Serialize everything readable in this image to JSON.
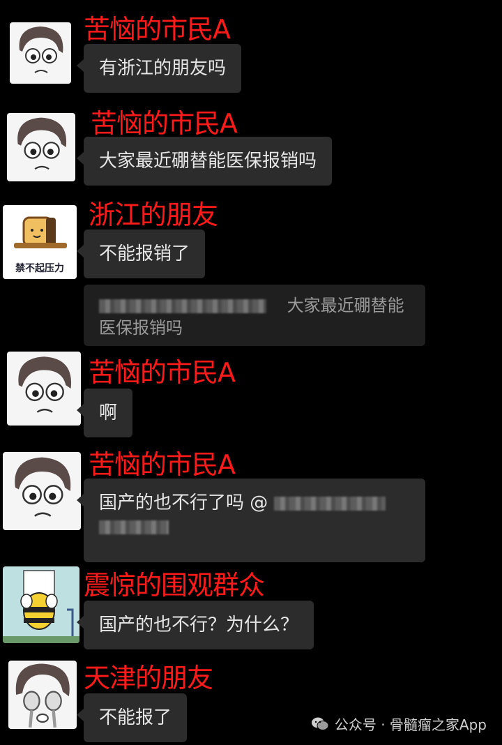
{
  "messages": [
    {
      "sender": "苦恼的市民A",
      "text": "有浙江的朋友吗",
      "avatar": "sad-girl-face-icon"
    },
    {
      "sender": "苦恼的市民A",
      "text": "大家最近硼替能医保报销吗",
      "avatar": "sad-girl-face-icon"
    },
    {
      "sender": "浙江的朋友",
      "text": "不能报销了",
      "avatar": "bread-sticker-icon",
      "avatar_caption": "禁不起压力",
      "quote_text_line1": "大家最近硼替能",
      "quote_text_line2": "医保报销吗"
    },
    {
      "sender": "苦恼的市民A",
      "text": "啊",
      "avatar": "sad-girl-face-icon"
    },
    {
      "sender": "苦恼的市民A",
      "text": "国产的也不行了吗 @",
      "avatar": "sad-girl-face-icon"
    },
    {
      "sender": "震惊的围观群众",
      "text": "国产的也不行？为什么？",
      "avatar": "bee-sticker-icon"
    },
    {
      "sender": "天津的朋友",
      "text": "不能报了",
      "avatar": "crying-face-icon"
    }
  ],
  "watermark": {
    "text": "公众号 · 骨髓瘤之家App",
    "icon": "wechat-icon"
  },
  "colors": {
    "background": "#000000",
    "bubble": "#2c2c2c",
    "sender": "#ff1a1a"
  }
}
